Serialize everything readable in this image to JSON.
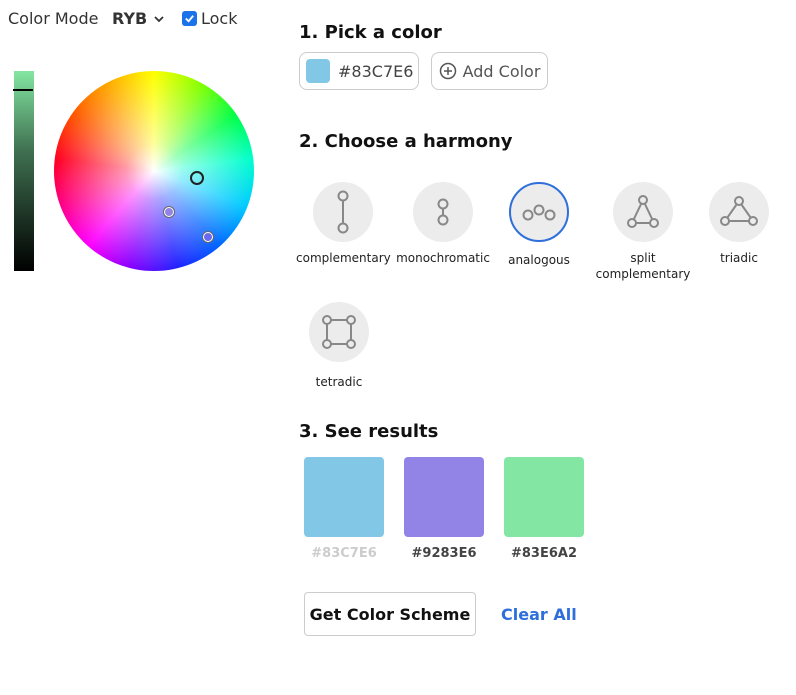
{
  "controls": {
    "mode_label": "Color Mode",
    "mode_value": "RYB",
    "lock_label": "Lock"
  },
  "steps": {
    "pick": "1. Pick a color",
    "harmony": "2. Choose a harmony",
    "results": "3. See results"
  },
  "picker": {
    "color_value": "#83C7E6",
    "swatch_color": "#83C7E6",
    "add_label": "Add Color"
  },
  "harmonies": [
    {
      "label": "complementary",
      "icon": "complementary-icon"
    },
    {
      "label": "monochromatic",
      "icon": "monochromatic-icon"
    },
    {
      "label": "analogous",
      "icon": "analogous-icon",
      "selected": true
    },
    {
      "label": "split complementary",
      "icon": "split-complementary-icon"
    },
    {
      "label": "triadic",
      "icon": "triadic-icon"
    },
    {
      "label": "tetradic",
      "icon": "tetradic-icon"
    }
  ],
  "results": [
    {
      "hex": "#83C7E6",
      "color": "#83C7E6",
      "label_color": "#cccccc"
    },
    {
      "hex": "#9283E6",
      "color": "#9283E6",
      "label_color": "#444444"
    },
    {
      "hex": "#83E6A2",
      "color": "#83E6A2",
      "label_color": "#444444"
    }
  ],
  "actions": {
    "scheme_label": "Get Color Scheme",
    "clear_label": "Clear All"
  },
  "colors": {
    "accent": "#2e6fdc",
    "checkbox": "#1a73e8"
  }
}
